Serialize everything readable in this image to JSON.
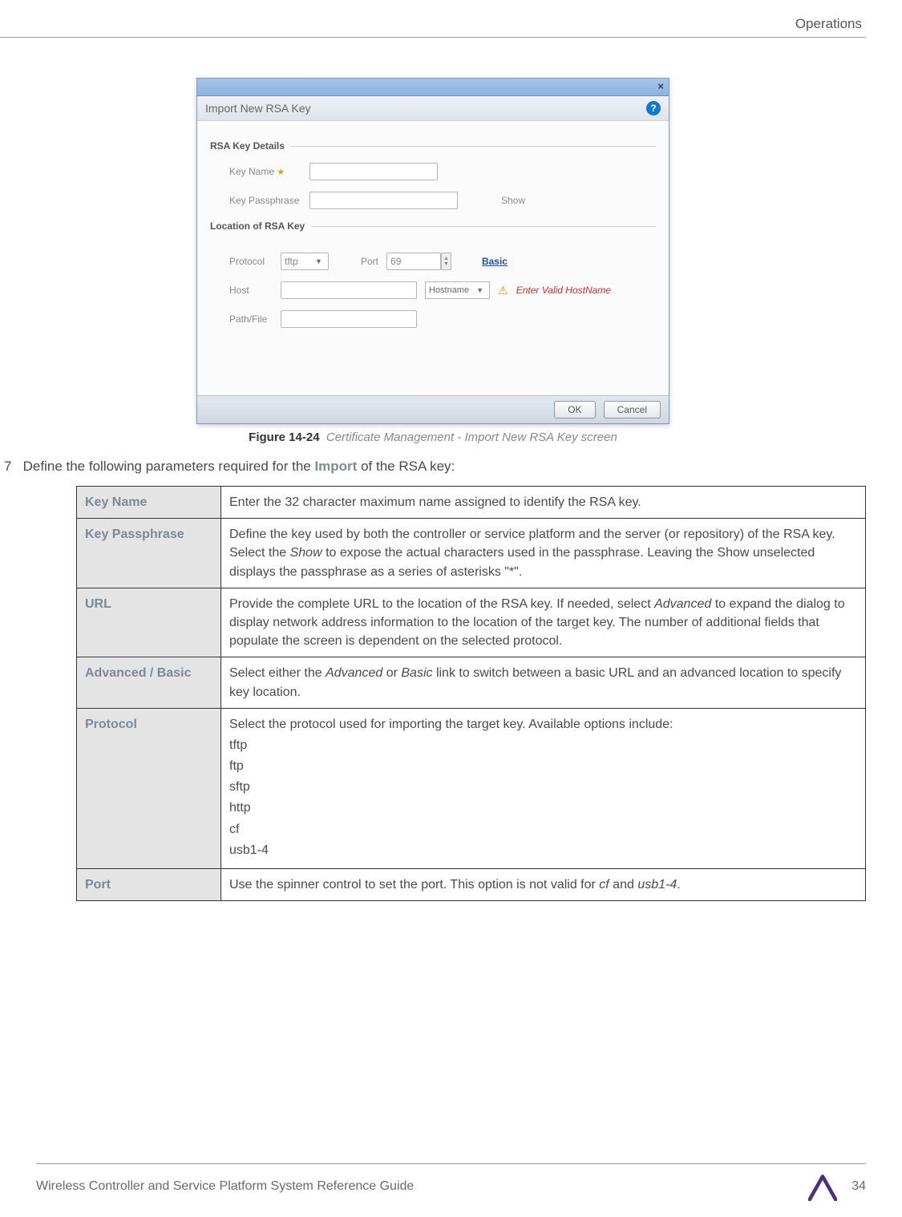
{
  "header": {
    "section": "Operations"
  },
  "dialog": {
    "title": "Import New RSA Key",
    "close_glyph": "×",
    "help_glyph": "?",
    "sections": {
      "details_header": "RSA Key Details",
      "location_header": "Location of RSA Key"
    },
    "labels": {
      "key_name": "Key Name",
      "key_passphrase": "Key Passphrase",
      "show": "Show",
      "protocol": "Protocol",
      "port": "Port",
      "host": "Host",
      "hostname": "Hostname",
      "path_file": "Path/File",
      "basic_link": "Basic"
    },
    "values": {
      "protocol": "tftp",
      "port": "69"
    },
    "error": "Enter Valid HostName",
    "buttons": {
      "ok": "OK",
      "cancel": "Cancel"
    }
  },
  "figure": {
    "label": "Figure 14-24",
    "caption": "Certificate Management - Import New RSA Key screen"
  },
  "step": {
    "num": "7",
    "pre": "Define the following parameters required for the ",
    "bold": "Import",
    "post": " of the RSA key:"
  },
  "table": {
    "rows": [
      {
        "key": "Key Name",
        "desc": "Enter the 32 character maximum name assigned to identify the RSA key."
      },
      {
        "key": "Key Passphrase",
        "desc": "Define the key used by both the controller or service platform and the server (or repository) of the RSA key. Select the <em>Show</em> to expose the actual characters used in the passphrase. Leaving the Show unselected displays the passphrase as a series of asterisks \"*\"."
      },
      {
        "key": "URL",
        "desc": "Provide the complete URL to the location of the RSA key. If needed, select <em>Advanced</em> to expand the dialog to display network address information to the location of the target key. The number of additional fields that populate the screen is dependent on the selected protocol."
      },
      {
        "key": "Advanced / Basic",
        "desc": "Select either the <em>Advanced</em> or <em>Basic</em> link to switch between a basic URL and an advanced location to specify key location."
      },
      {
        "key": "Protocol",
        "desc": "Select the protocol used for importing the target key. Available options include:",
        "list": [
          "tftp",
          "ftp",
          "sftp",
          "http",
          "cf",
          "usb1-4"
        ]
      },
      {
        "key": "Port",
        "desc": "Use the spinner control to set the port. This option is not valid for <em>cf</em> and <em>usb1-4</em>."
      }
    ]
  },
  "footer": {
    "doc": "Wireless Controller and Service Platform System Reference Guide",
    "page": "34"
  }
}
